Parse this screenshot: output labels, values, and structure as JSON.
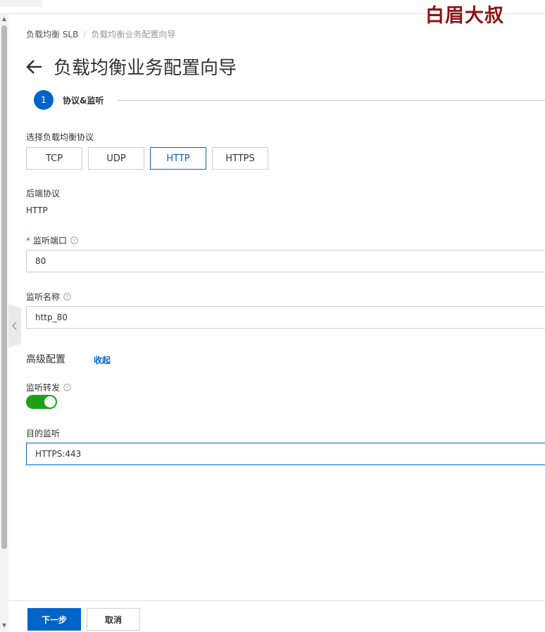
{
  "watermark": "白眉大叔",
  "breadcrumb": {
    "root": "负载均衡 SLB",
    "separator": "/",
    "current": "负载均衡业务配置向导"
  },
  "page": {
    "title": "负载均衡业务配置向导",
    "back_icon": "arrow-left-icon"
  },
  "steps": [
    {
      "number": "1",
      "label": "协议&监听"
    }
  ],
  "protocol": {
    "label": "选择负载均衡协议",
    "options": [
      "TCP",
      "UDP",
      "HTTP",
      "HTTPS"
    ],
    "selected": "HTTP"
  },
  "backend": {
    "label": "后端协议",
    "value": "HTTP"
  },
  "listen_port": {
    "required_mark": "*",
    "label": "监听端口",
    "value": "80"
  },
  "listen_name": {
    "label": "监听名称",
    "value": "http_80"
  },
  "advanced": {
    "title": "高级配置",
    "toggle_link": "收起"
  },
  "forwarding": {
    "label": "监听转发",
    "enabled": true
  },
  "target": {
    "label": "目的监听",
    "value": "HTTPS:443"
  },
  "footer": {
    "next_label": "下一步",
    "cancel_label": "取消"
  },
  "colors": {
    "primary": "#0064c8",
    "toggle_on": "#1aa316",
    "watermark": "#8b1414"
  }
}
